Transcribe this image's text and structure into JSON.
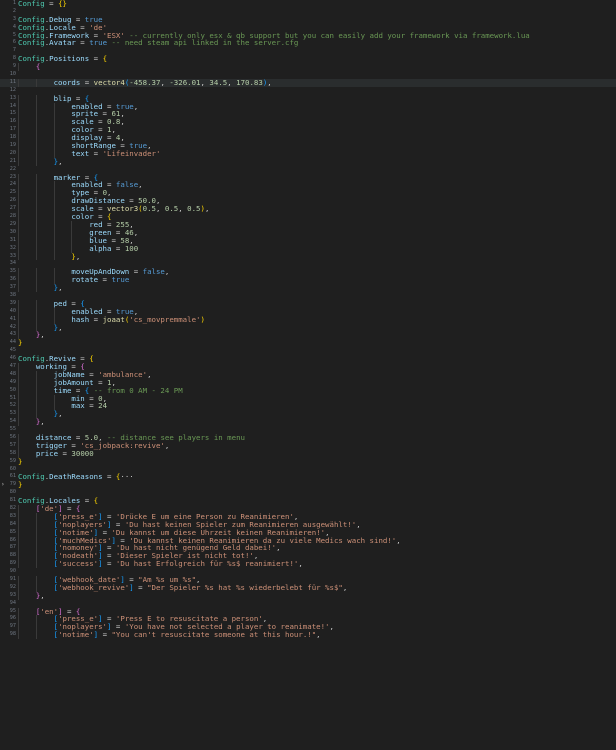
{
  "editor": {
    "language": "lua",
    "lines": [
      {
        "n": "1",
        "t": "Config = {}"
      },
      {
        "n": "2",
        "t": ""
      },
      {
        "n": "3",
        "t": "Config.Debug = true"
      },
      {
        "n": "4",
        "t": "Config.Locale = 'de'"
      },
      {
        "n": "5",
        "t": "Config.Framework = 'ESX' -- currently only esx & qb support but you can easily add your framework via framework.lua"
      },
      {
        "n": "6",
        "t": "Config.Avatar = true -- need steam api linked in the server.cfg"
      },
      {
        "n": "7",
        "t": ""
      },
      {
        "n": "8",
        "t": "Config.Positions = {"
      },
      {
        "n": "9",
        "t": "    {"
      },
      {
        "n": "10",
        "t": ""
      },
      {
        "n": "11",
        "t": "        coords = vector4(-458.37, -326.01, 34.5, 170.83),"
      },
      {
        "n": "12",
        "t": ""
      },
      {
        "n": "13",
        "t": "        blip = {"
      },
      {
        "n": "14",
        "t": "            enabled = true,"
      },
      {
        "n": "15",
        "t": "            sprite = 61,"
      },
      {
        "n": "16",
        "t": "            scale = 0.8,"
      },
      {
        "n": "17",
        "t": "            color = 1,"
      },
      {
        "n": "18",
        "t": "            display = 4,"
      },
      {
        "n": "19",
        "t": "            shortRange = true,"
      },
      {
        "n": "20",
        "t": "            text = 'Lifeinvader'"
      },
      {
        "n": "21",
        "t": "        },"
      },
      {
        "n": "22",
        "t": ""
      },
      {
        "n": "23",
        "t": "        marker = {"
      },
      {
        "n": "24",
        "t": "            enabled = false,"
      },
      {
        "n": "25",
        "t": "            type = 0,"
      },
      {
        "n": "26",
        "t": "            drawDistance = 50.0,"
      },
      {
        "n": "27",
        "t": "            scale = vector3(0.5, 0.5, 0.5),"
      },
      {
        "n": "28",
        "t": "            color = {"
      },
      {
        "n": "29",
        "t": "                red = 255,"
      },
      {
        "n": "30",
        "t": "                green = 46,"
      },
      {
        "n": "31",
        "t": "                blue = 58,"
      },
      {
        "n": "32",
        "t": "                alpha = 100"
      },
      {
        "n": "33",
        "t": "            },"
      },
      {
        "n": "34",
        "t": ""
      },
      {
        "n": "35",
        "t": "            moveUpAndDown = false,"
      },
      {
        "n": "36",
        "t": "            rotate = true"
      },
      {
        "n": "37",
        "t": "        },"
      },
      {
        "n": "38",
        "t": ""
      },
      {
        "n": "39",
        "t": "        ped = {"
      },
      {
        "n": "40",
        "t": "            enabled = true,"
      },
      {
        "n": "41",
        "t": "            hash = joaat('cs_movpremmale')"
      },
      {
        "n": "42",
        "t": "        },"
      },
      {
        "n": "43",
        "t": "    },"
      },
      {
        "n": "44",
        "t": "}"
      },
      {
        "n": "45",
        "t": ""
      },
      {
        "n": "46",
        "t": "Config.Revive = {"
      },
      {
        "n": "47",
        "t": "    working = {"
      },
      {
        "n": "48",
        "t": "        jobName = 'ambulance',"
      },
      {
        "n": "49",
        "t": "        jobAmount = 1,"
      },
      {
        "n": "50",
        "t": "        time = { -- from 0 AM - 24 PM"
      },
      {
        "n": "51",
        "t": "            min = 0,"
      },
      {
        "n": "52",
        "t": "            max = 24"
      },
      {
        "n": "53",
        "t": "        },"
      },
      {
        "n": "54",
        "t": "    },"
      },
      {
        "n": "55",
        "t": ""
      },
      {
        "n": "56",
        "t": "    distance = 5.0, -- distance see players in menu"
      },
      {
        "n": "57",
        "t": "    trigger = 'cs_jobpack:revive',"
      },
      {
        "n": "58",
        "t": "    price = 30000"
      },
      {
        "n": "59",
        "t": "}"
      },
      {
        "n": "60",
        "t": ""
      },
      {
        "n": "61",
        "t": "Config.DeathReasons = {···"
      },
      {
        "n": "79",
        "t": "}"
      },
      {
        "n": "80",
        "t": ""
      },
      {
        "n": "81",
        "t": "Config.Locales = {"
      },
      {
        "n": "82",
        "t": "    ['de'] = {"
      },
      {
        "n": "83",
        "t": "        ['press_e'] = 'Drücke E um eine Person zu Reanimieren',"
      },
      {
        "n": "84",
        "t": "        ['noplayers'] = 'Du hast keinen Spieler zum Reanimieren ausgewählt!',"
      },
      {
        "n": "85",
        "t": "        ['notime'] = 'Du kannst um diese Uhrzeit keinen Reanimieren!',"
      },
      {
        "n": "86",
        "t": "        ['muchMedics'] = 'Du kannst keinen Reanimieren da zu viele Medics wach sind!',"
      },
      {
        "n": "87",
        "t": "        ['nomoney'] = 'Du hast nicht genügend Geld dabei!',"
      },
      {
        "n": "88",
        "t": "        ['nodeath'] = 'Dieser Spieler ist nicht tot!',"
      },
      {
        "n": "89",
        "t": "        ['success'] = 'Du hast Erfolgreich für %s$ reanimiert!',"
      },
      {
        "n": "90",
        "t": ""
      },
      {
        "n": "91",
        "t": "        ['webhook_date'] = \"Am %s um %s\","
      },
      {
        "n": "92",
        "t": "        ['webhook_revive'] = \"Der Spieler %s hat %s wiederbelebt für %s$\","
      },
      {
        "n": "93",
        "t": "    },"
      },
      {
        "n": "94",
        "t": ""
      },
      {
        "n": "95",
        "t": "    ['en'] = {"
      },
      {
        "n": "96",
        "t": "        ['press_e'] = 'Press E to resuscitate a person',"
      },
      {
        "n": "97",
        "t": "        ['noplayers'] = 'You have not selected a player to reanimate!',"
      },
      {
        "n": "98",
        "t": "        ['notime'] = \"You can't resuscitate someone at this hour.!\","
      }
    ],
    "current_line_index": 10,
    "folded_line_index": 61,
    "colors": {
      "background": "#1f1f1f",
      "current_line": "#2a2d2e",
      "line_number": "#6e7681",
      "global": "#4ec9b0",
      "property": "#9cdcfe",
      "string": "#ce9178",
      "number": "#b5cea8",
      "keyword": "#569cd6",
      "function": "#dcdcaa",
      "comment": "#6a9955"
    }
  }
}
